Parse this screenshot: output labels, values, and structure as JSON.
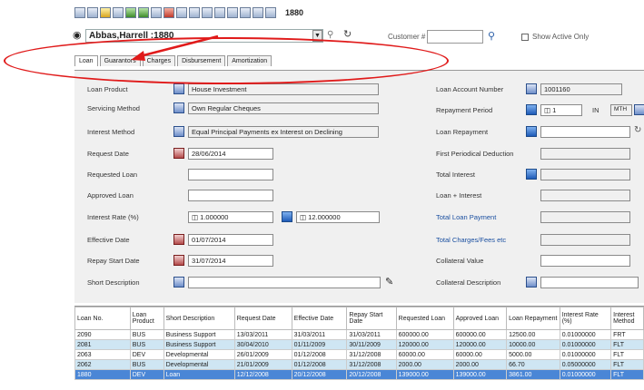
{
  "toolbar": {
    "record_number": "1880"
  },
  "header": {
    "name_value": "Abbas,Harrell :1880",
    "customer_label": "Customer #",
    "customer_value": "",
    "show_active_label": "Show Active Only"
  },
  "tabs": [
    {
      "label": "Loan"
    },
    {
      "label": "Guarantors"
    },
    {
      "label": "Charges"
    },
    {
      "label": "Disbursement"
    },
    {
      "label": "Amortization"
    }
  ],
  "form": {
    "loan_product_label": "Loan Product",
    "loan_product_value": "House Investment",
    "servicing_method_label": "Servicing Method",
    "servicing_method_value": "Own Regular Cheques",
    "interest_method_label": "Interest Method",
    "interest_method_value": "Equal Principal Payments ex Interest on Declining",
    "request_date_label": "Request Date",
    "request_date_value": "28/06/2014",
    "requested_loan_label": "Requested Loan",
    "approved_loan_label": "Approved Loan",
    "interest_rate_label": "Interest Rate (%)",
    "interest_rate_value": "1.000000",
    "interest_rate_value2": "12.000000",
    "effective_date_label": "Effective Date",
    "effective_date_value": "01/07/2014",
    "repay_start_label": "Repay Start Date",
    "repay_start_value": "31/07/2014",
    "short_desc_label": "Short Description",
    "loan_account_label": "Loan Account Number",
    "loan_account_value": "1001160",
    "repayment_period_label": "Repayment Period",
    "repayment_period_value": "1",
    "in_label": "IN",
    "mth_value": "MTH",
    "loan_repayment_label": "Loan Repayment",
    "first_deduction_label": "First Periodical Deduction",
    "total_interest_label": "Total Interest",
    "loan_plus_interest_label": "Loan + Interest",
    "total_loan_payment_label": "Total Loan Payment",
    "total_charges_label": "Total Charges/Fees etc",
    "collateral_value_label": "Collateral Value",
    "collateral_desc_label": "Collateral Description"
  },
  "grid": {
    "headers": [
      "Loan No.",
      "Loan Product",
      "Short Description",
      "Request Date",
      "Effective Date",
      "Repay Start Date",
      "Requested Loan",
      "Approved Loan",
      "Loan Repayment",
      "Interest Rate (%)",
      "Interest Method"
    ],
    "rows": [
      [
        "2090",
        "BUS",
        "Business Support",
        "13/03/2011",
        "31/03/2011",
        "31/03/2011",
        "600000.00",
        "600000.00",
        "12500.00",
        "0.01000000",
        "FRT"
      ],
      [
        "2081",
        "BUS",
        "Business Support",
        "30/04/2010",
        "01/11/2009",
        "30/11/2009",
        "120000.00",
        "120000.00",
        "10000.00",
        "0.01000000",
        "FLT"
      ],
      [
        "2063",
        "DEV",
        "Developmental",
        "26/01/2009",
        "01/12/2008",
        "31/12/2008",
        "60000.00",
        "60000.00",
        "5000.00",
        "0.01000000",
        "FLT"
      ],
      [
        "2062",
        "BUS",
        "Developmental",
        "21/01/2009",
        "01/12/2008",
        "31/12/2008",
        "2000.00",
        "2000.00",
        "66.70",
        "0.05000000",
        "FLT"
      ],
      [
        "1880",
        "DEV",
        "Loan",
        "12/12/2008",
        "20/12/2008",
        "20/12/2008",
        "139000.00",
        "139000.00",
        "3861.00",
        "0.01000000",
        "FLT"
      ]
    ]
  }
}
